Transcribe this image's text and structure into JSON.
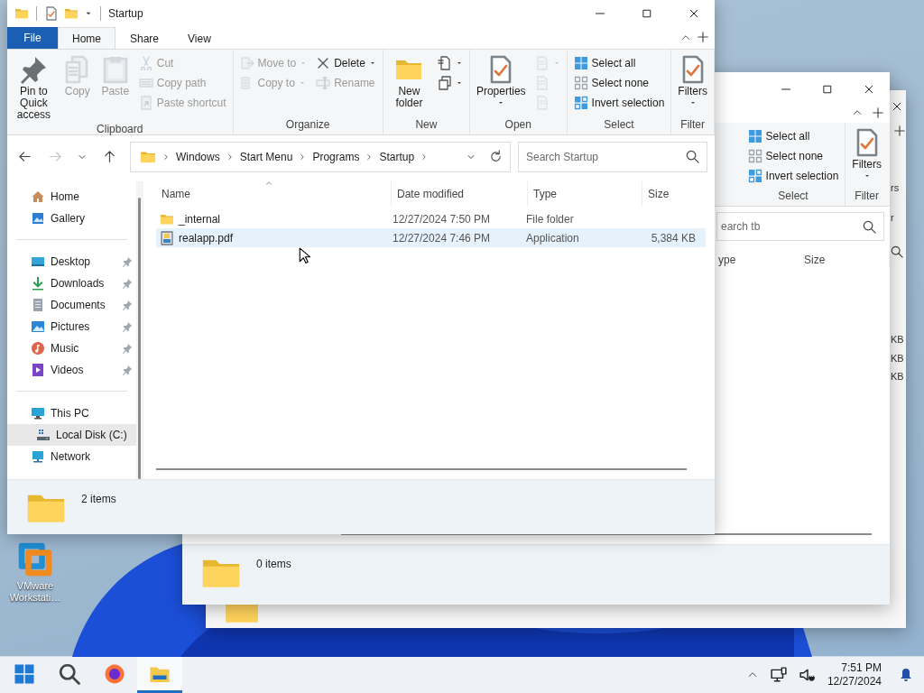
{
  "desktop": {
    "shortcut": {
      "label": "VMware Workstati…"
    }
  },
  "back_window": {
    "ribbon_fragments": [
      "rs",
      "r"
    ],
    "size_fragments": [
      "KB",
      "KB",
      "KB"
    ]
  },
  "middle_window": {
    "select_group": {
      "label": "Select",
      "buttons": [
        {
          "label": "Select all"
        },
        {
          "label": "Select none"
        },
        {
          "label": "Invert selection"
        }
      ]
    },
    "filter_group": {
      "label": "Filter",
      "button": "Filters"
    },
    "search": {
      "placeholder": "earch tb"
    },
    "columns": [
      "ype",
      "Size"
    ],
    "status": "0 items"
  },
  "window": {
    "title": "Startup",
    "ribbon_tabs": [
      {
        "label": "File",
        "kind": "file",
        "selected": false
      },
      {
        "label": "Home",
        "kind": "tab",
        "selected": true
      },
      {
        "label": "Share",
        "kind": "tab",
        "selected": false
      },
      {
        "label": "View",
        "kind": "tab",
        "selected": false
      }
    ],
    "ribbon_groups": [
      {
        "label": "Clipboard",
        "columns": [
          {
            "kind": "large",
            "items": [
              {
                "label": "Pin to Quick access",
                "disabled": false,
                "dropdown": false
              }
            ]
          },
          {
            "kind": "large",
            "items": [
              {
                "label": "Copy",
                "disabled": true,
                "dropdown": false
              }
            ]
          },
          {
            "kind": "large",
            "items": [
              {
                "label": "Paste",
                "disabled": true,
                "dropdown": false
              }
            ]
          },
          {
            "kind": "small",
            "items": [
              {
                "label": "Cut",
                "disabled": true,
                "dropdown": false
              },
              {
                "label": "Copy path",
                "disabled": true,
                "dropdown": false
              },
              {
                "label": "Paste shortcut",
                "disabled": true,
                "dropdown": false
              }
            ]
          }
        ]
      },
      {
        "label": "Organize",
        "columns": [
          {
            "kind": "small",
            "items": [
              {
                "label": "Move to",
                "disabled": true,
                "dropdown": true
              },
              {
                "label": "Copy to",
                "disabled": true,
                "dropdown": true
              }
            ]
          },
          {
            "kind": "small",
            "items": [
              {
                "label": "Delete",
                "disabled": false,
                "dropdown": true
              },
              {
                "label": "Rename",
                "disabled": true,
                "dropdown": false
              }
            ]
          }
        ]
      },
      {
        "label": "New",
        "columns": [
          {
            "kind": "large",
            "items": [
              {
                "label": "New folder",
                "disabled": false,
                "dropdown": false
              }
            ]
          },
          {
            "kind": "icons",
            "items": [
              {
                "disabled": false,
                "dropdown": true
              },
              {
                "disabled": false,
                "dropdown": true
              }
            ]
          }
        ]
      },
      {
        "label": "Open",
        "columns": [
          {
            "kind": "large",
            "items": [
              {
                "label": "Properties",
                "disabled": false,
                "dropdown": true
              }
            ]
          },
          {
            "kind": "icons",
            "items": [
              {
                "disabled": true,
                "dropdown": true
              },
              {
                "disabled": true,
                "dropdown": false
              },
              {
                "disabled": true,
                "dropdown": false
              }
            ]
          }
        ]
      },
      {
        "label": "Select",
        "columns": [
          {
            "kind": "small",
            "items": [
              {
                "label": "Select all",
                "disabled": false,
                "dropdown": false
              },
              {
                "label": "Select none",
                "disabled": false,
                "dropdown": false
              },
              {
                "label": "Invert selection",
                "disabled": false,
                "dropdown": false
              }
            ]
          }
        ]
      },
      {
        "label": "Filter",
        "columns": [
          {
            "kind": "large",
            "items": [
              {
                "label": "Filters",
                "disabled": false,
                "dropdown": true
              }
            ]
          }
        ]
      }
    ],
    "nav_buttons": [
      {
        "disabled": false
      },
      {
        "disabled": true
      },
      {
        "disabled": false
      },
      {
        "disabled": false
      }
    ],
    "breadcrumbs": [
      "Windows",
      "Start Menu",
      "Programs",
      "Startup"
    ],
    "search": {
      "placeholder": "Search Startup"
    },
    "sidebar": {
      "sections": [
        {
          "items": [
            {
              "label": "Home",
              "pinned": false,
              "selected": false
            },
            {
              "label": "Gallery",
              "pinned": false,
              "selected": false
            }
          ]
        },
        {
          "items": [
            {
              "label": "Desktop",
              "pinned": true,
              "selected": false
            },
            {
              "label": "Downloads",
              "pinned": true,
              "selected": false
            },
            {
              "label": "Documents",
              "pinned": true,
              "selected": false
            },
            {
              "label": "Pictures",
              "pinned": true,
              "selected": false
            },
            {
              "label": "Music",
              "pinned": true,
              "selected": false
            },
            {
              "label": "Videos",
              "pinned": true,
              "selected": false
            }
          ]
        },
        {
          "items": [
            {
              "label": "This PC",
              "pinned": false,
              "selected": false,
              "children": [
                {
                  "label": "Local Disk (C:)",
                  "pinned": false,
                  "selected": true
                }
              ]
            },
            {
              "label": "Network",
              "pinned": false,
              "selected": false
            }
          ]
        }
      ]
    },
    "columns": [
      {
        "label": "Name",
        "sorted": true
      },
      {
        "label": "Date modified",
        "sorted": false
      },
      {
        "label": "Type",
        "sorted": false
      },
      {
        "label": "Size",
        "sorted": false
      }
    ],
    "rows": [
      {
        "kind": "folder",
        "name": "_internal",
        "date": "12/27/2024 7:50 PM",
        "type": "File folder",
        "hovered": false
      },
      {
        "kind": "app",
        "name": "realapp.pdf",
        "date": "12/27/2024 7:46 PM",
        "type": "Application",
        "size": "5,384 KB",
        "hovered": true
      }
    ],
    "status": "2 items"
  },
  "taskbar": {
    "apps": [
      {
        "selected": false
      },
      {
        "selected": false
      },
      {
        "selected": false
      },
      {
        "selected": true
      }
    ],
    "clock": {
      "time": "7:51 PM",
      "date": "12/27/2024"
    }
  }
}
